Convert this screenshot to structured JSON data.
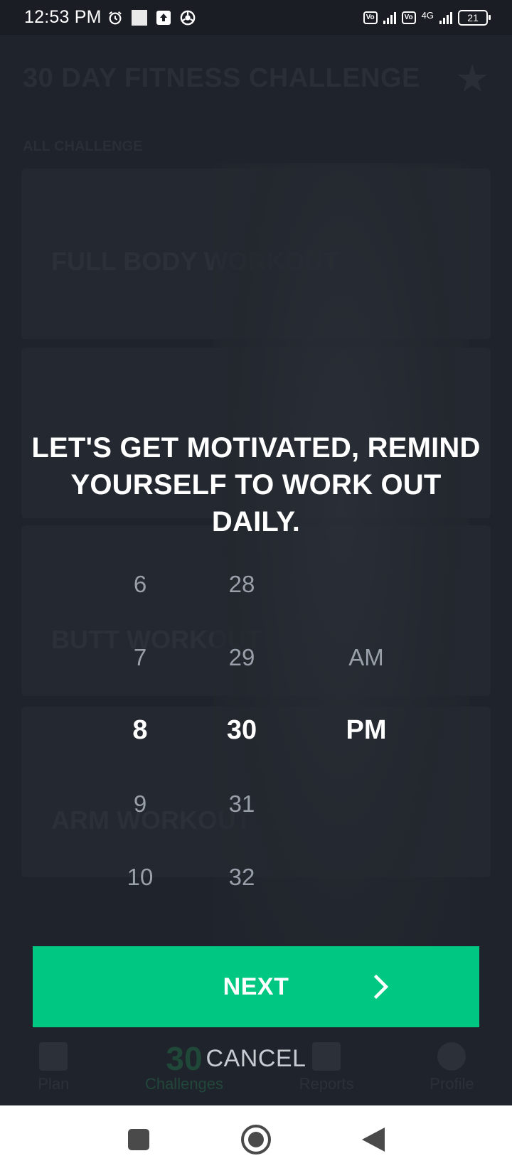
{
  "status_bar": {
    "time": "12:53 PM",
    "network": "4G",
    "battery": "21"
  },
  "background_app": {
    "title": "30 DAY FITNESS CHALLENGE",
    "section_label": "ALL CHALLENGE",
    "cards": [
      {
        "label": "FULL BODY WORKOUT"
      },
      {
        "label": "BUTT WORKOUT"
      },
      {
        "label": "ARM WORKOUT"
      }
    ],
    "nav": [
      {
        "label": "Plan"
      },
      {
        "label": "Challenges",
        "badge": "30"
      },
      {
        "label": "Reports"
      },
      {
        "label": "Profile"
      }
    ]
  },
  "dialog": {
    "headline_line1": "LET'S GET MOTIVATED, REMIND",
    "headline_line2": "YOURSELF TO WORK OUT DAILY.",
    "picker": {
      "hours": [
        "6",
        "7",
        "8",
        "9",
        "10"
      ],
      "minutes": [
        "28",
        "29",
        "30",
        "31",
        "32"
      ],
      "ampm": [
        "AM",
        "PM"
      ],
      "selected_hour": "8",
      "selected_minute": "30",
      "selected_ampm": "PM"
    },
    "next_label": "NEXT",
    "cancel_label": "CANCEL"
  },
  "colors": {
    "accent": "#00c781",
    "background": "#1f232b"
  }
}
